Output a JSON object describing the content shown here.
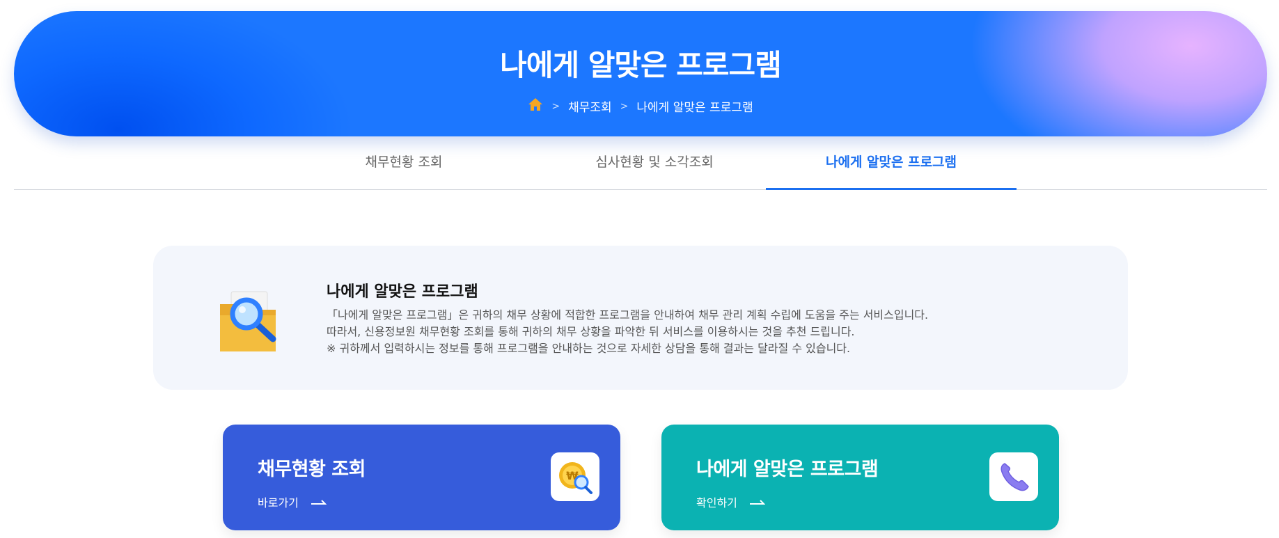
{
  "hero": {
    "title": "나에게 알맞은 프로그램",
    "breadcrumb": {
      "home_icon": "home-icon",
      "separator": ">",
      "items": [
        "채무조회",
        "나에게 알맞은 프로그램"
      ]
    }
  },
  "tabs": [
    {
      "label": "채무현황 조회",
      "active": false
    },
    {
      "label": "심사현황 및 소각조회",
      "active": false
    },
    {
      "label": "나에게 알맞은 프로그램",
      "active": true
    }
  ],
  "info": {
    "icon": "folder-search-icon",
    "title": "나에게 알맞은 프로그램",
    "lines": [
      "「나에게 알맞은 프로그램」은 귀하의 채무 상황에 적합한 프로그램을 안내하여 채무 관리 계획 수립에 도움을 주는 서비스입니다.",
      "따라서, 신용정보원 채무현황 조회를 통해 귀하의 채무 상황을 파악한 뒤 서비스를 이용하시는 것을 추천 드립니다.",
      "※ 귀하께서 입력하시는 정보를 통해 프로그램을 안내하는 것으로 자세한 상담을 통해 결과는 달라질 수 있습니다."
    ]
  },
  "cards": [
    {
      "title": "채무현황 조회",
      "link": "바로가기",
      "icon": "coin-search-icon"
    },
    {
      "title": "나에게 알맞은 프로그램",
      "link": "확인하기",
      "icon": "phone-icon"
    }
  ],
  "colors": {
    "accent": "#1b6ff0",
    "card_blue": "#365cdb",
    "card_teal": "#0bb2b2",
    "info_bg": "#f3f6fc"
  }
}
